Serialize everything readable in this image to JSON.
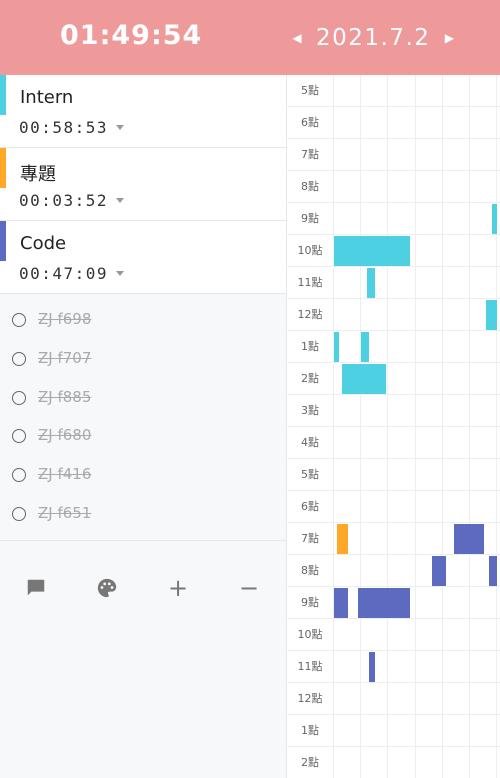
{
  "header": {
    "timer": "01:49:54",
    "date": "2021.7.2",
    "prev_icon": "caret-left-icon",
    "next_icon": "caret-right-icon",
    "background": "#ef9a9a"
  },
  "tasks": [
    {
      "name": "Intern",
      "time": "00:58:53",
      "color": "#4dd0e1"
    },
    {
      "name": "專題",
      "time": "00:03:52",
      "color": "#ffa726"
    },
    {
      "name": "Code",
      "time": "00:47:09",
      "color": "#5c6bc0"
    }
  ],
  "todos": [
    {
      "label": "ZJ f698",
      "done": true
    },
    {
      "label": "ZJ f707",
      "done": true
    },
    {
      "label": "ZJ f885",
      "done": true
    },
    {
      "label": "ZJ f680",
      "done": true
    },
    {
      "label": "ZJ f416",
      "done": true
    },
    {
      "label": "ZJ f651",
      "done": true
    }
  ],
  "toolbar": {
    "icons": [
      "comment-icon",
      "palette-icon",
      "plus-icon",
      "minus-icon"
    ],
    "plus_label": "+",
    "minus_label": "−"
  },
  "timeline": {
    "hours": [
      "5點",
      "6點",
      "7點",
      "8點",
      "9點",
      "10點",
      "11點",
      "12點",
      "1點",
      "2點",
      "3點",
      "4點",
      "5點",
      "6點",
      "7點",
      "8點",
      "9點",
      "10點",
      "11點",
      "12點",
      "1點",
      "2點"
    ],
    "blocks": [
      {
        "task": "Intern",
        "hour": 4,
        "start_min": 58,
        "end_min": 60
      },
      {
        "task": "Intern",
        "hour": 5,
        "start_min": 0,
        "end_min": 28
      },
      {
        "task": "Intern",
        "hour": 6,
        "start_min": 12,
        "end_min": 15
      },
      {
        "task": "Intern",
        "hour": 7,
        "start_min": 56,
        "end_min": 60
      },
      {
        "task": "Intern",
        "hour": 8,
        "start_min": 0,
        "end_min": 2
      },
      {
        "task": "Intern",
        "hour": 8,
        "start_min": 10,
        "end_min": 13
      },
      {
        "task": "Intern",
        "hour": 9,
        "start_min": 3,
        "end_min": 19
      },
      {
        "task": "專題",
        "hour": 14,
        "start_min": 1,
        "end_min": 5
      },
      {
        "task": "Code",
        "hour": 14,
        "start_min": 44,
        "end_min": 55
      },
      {
        "task": "Code",
        "hour": 15,
        "start_min": 36,
        "end_min": 41
      },
      {
        "task": "Code",
        "hour": 15,
        "start_min": 57,
        "end_min": 60
      },
      {
        "task": "Code",
        "hour": 16,
        "start_min": 0,
        "end_min": 5
      },
      {
        "task": "Code",
        "hour": 16,
        "start_min": 9,
        "end_min": 28
      },
      {
        "task": "Code",
        "hour": 18,
        "start_min": 13,
        "end_min": 15
      }
    ]
  }
}
